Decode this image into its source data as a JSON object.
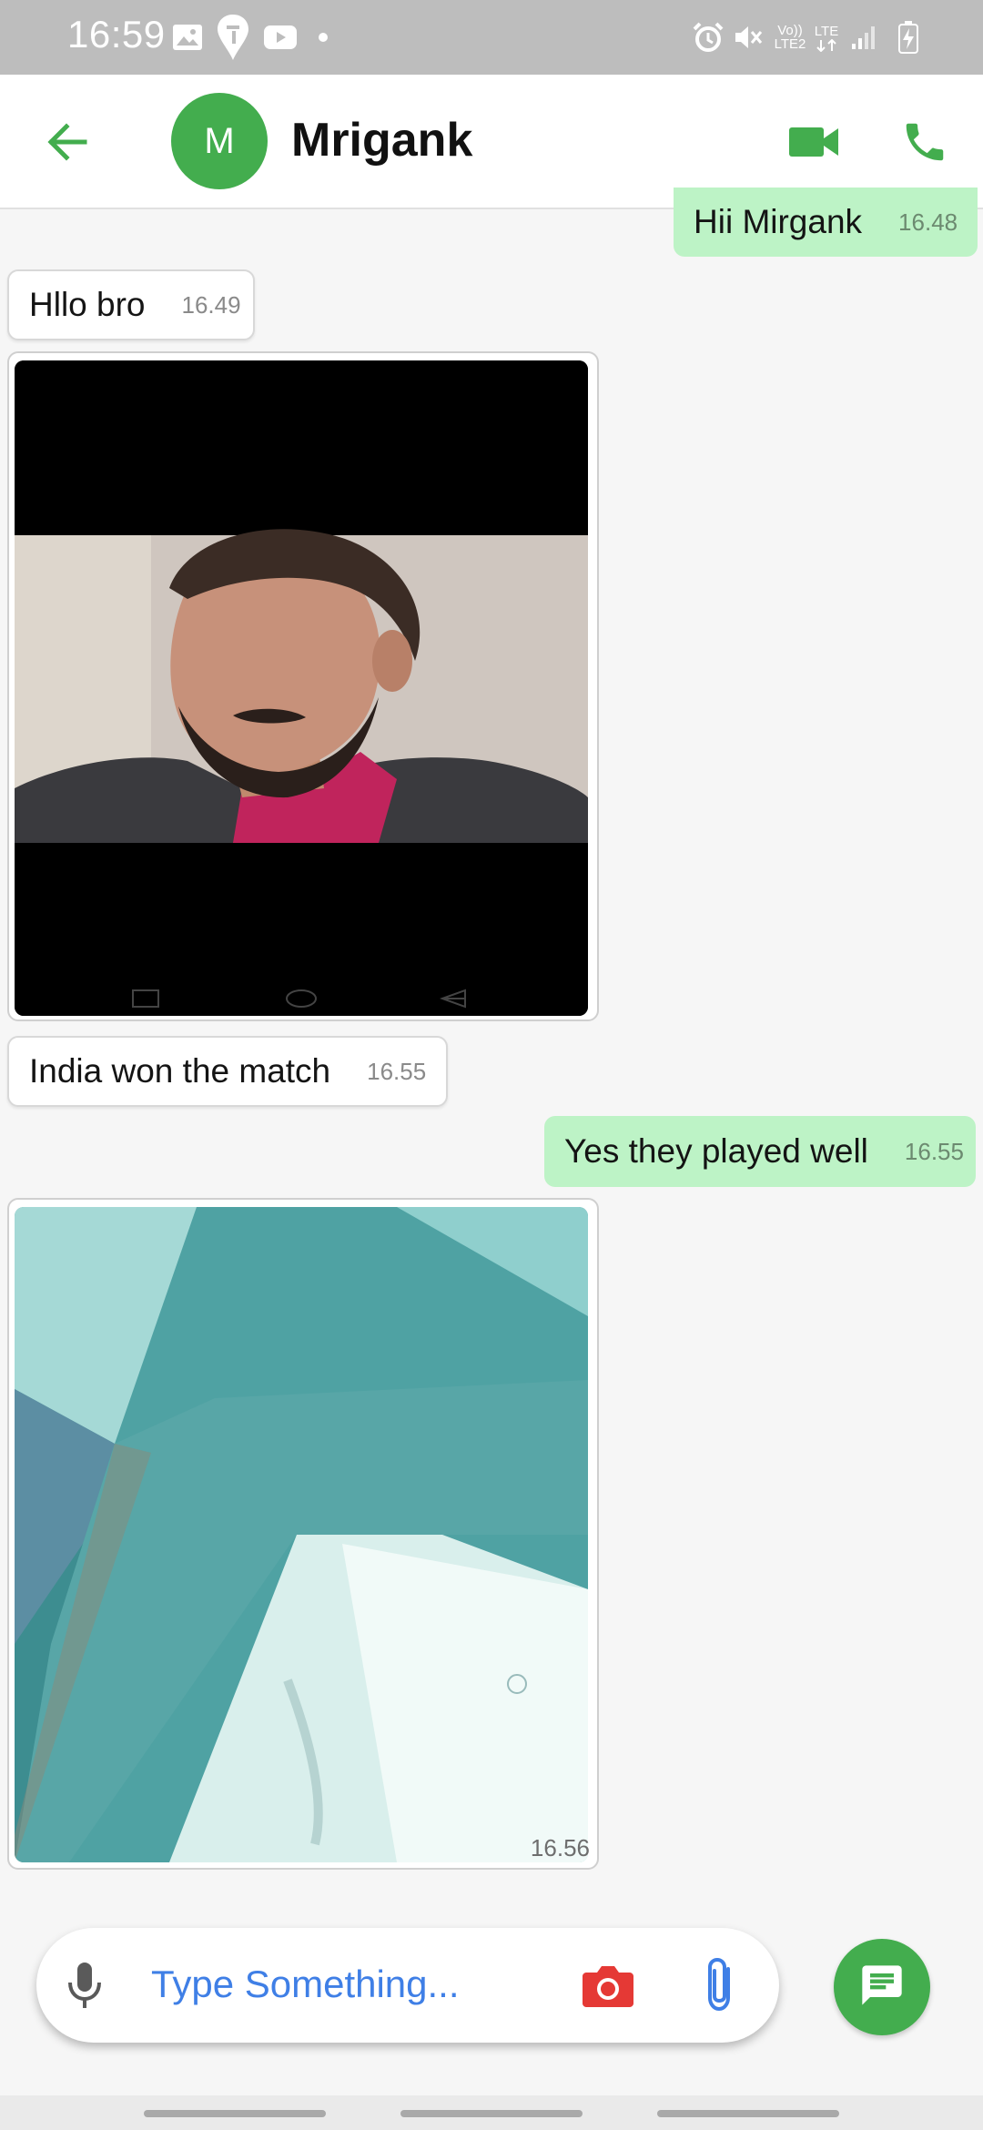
{
  "status_bar": {
    "time": "16:59",
    "left_icons": [
      "gallery-icon",
      "swiggy-icon",
      "youtube-icon",
      "dot-icon"
    ],
    "right_icons": [
      "alarm-icon",
      "mute-icon",
      "volte-icon",
      "lte-icon",
      "signal-icon",
      "battery-charging-icon"
    ],
    "volte_text": "Vo)) LTE2",
    "lte_text": "LTE"
  },
  "app_bar": {
    "avatar_initial": "M",
    "contact_name": "Mrigank",
    "icons": [
      "back-arrow-icon",
      "video-call-icon",
      "phone-icon"
    ]
  },
  "messages": [
    {
      "direction": "out",
      "type": "text",
      "text": "Hii Mirgank",
      "time": "16.48"
    },
    {
      "direction": "in",
      "type": "text",
      "text": "Hllo bro",
      "time": "16.49"
    },
    {
      "direction": "in",
      "type": "image",
      "description_icon": "photo-portrait-image",
      "time": ""
    },
    {
      "direction": "in",
      "type": "text",
      "text": "India won the match",
      "time": "16.55"
    },
    {
      "direction": "out",
      "type": "text",
      "text": "Yes they played well",
      "time": "16.55"
    },
    {
      "direction": "in",
      "type": "image",
      "description_icon": "photo-wall-image",
      "time": "16.56"
    }
  ],
  "input": {
    "placeholder": "Type Something...",
    "icons": [
      "mic-icon",
      "camera-icon",
      "attach-icon"
    ],
    "send_icon": "message-icon"
  },
  "colors": {
    "accent_green": "#43ad4e",
    "outgoing_bubble": "#bdf3c6",
    "incoming_bubble": "#ffffff",
    "placeholder_blue": "#3f7fe6",
    "camera_red": "#e53935"
  }
}
